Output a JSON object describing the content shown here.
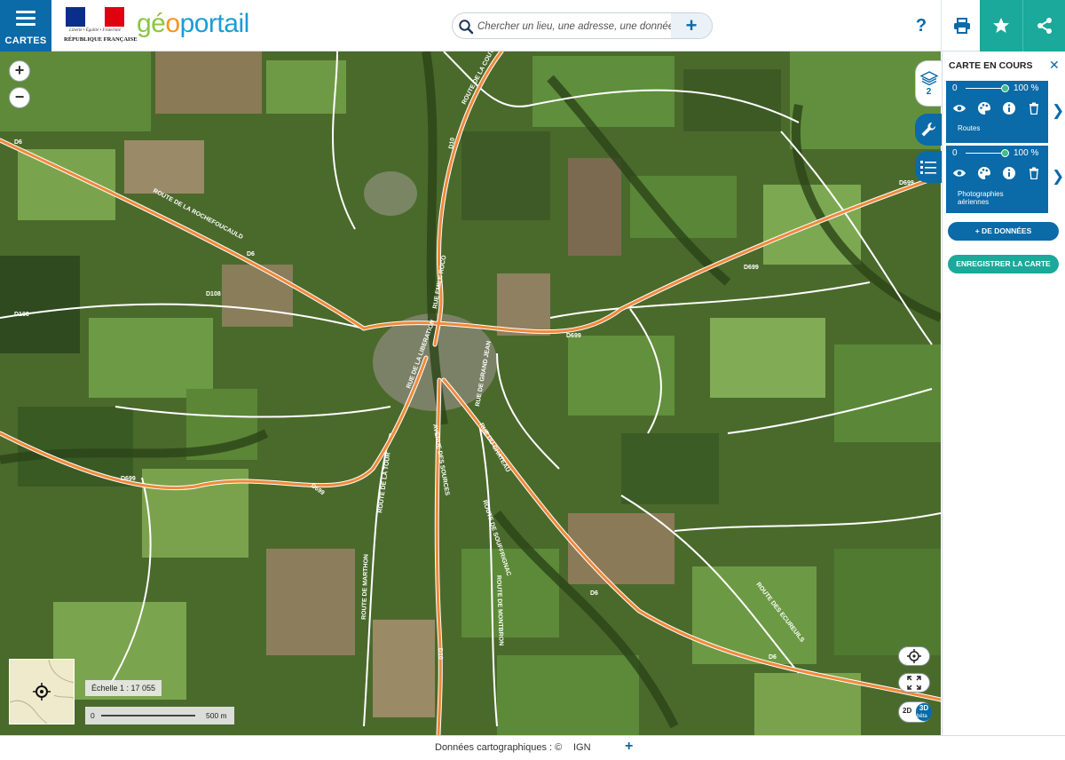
{
  "header": {
    "menu_label": "CARTES",
    "gov_logo_motto": "Liberté • Égalité • Fraternité",
    "gov_logo_name": "RÉPUBLIQUE FRANÇAISE",
    "brand_part1": "gé",
    "brand_part2": "o",
    "brand_part3": "portail",
    "search_placeholder": "Chercher un lieu, une adresse, une donnée",
    "search_add_label": "+",
    "help_label": "?",
    "icons": [
      "menu-icon",
      "search-icon",
      "print-icon",
      "star-icon",
      "share-icon"
    ],
    "colors": {
      "primary": "#0b6aa8",
      "accent": "#1aa99a",
      "brand_green": "#8cc63f",
      "brand_orange": "#f7931e",
      "brand_blue": "#1b9cd7"
    }
  },
  "map": {
    "zoom_in_label": "+",
    "zoom_out_label": "−",
    "scale_label": "Échelle 1 : 17 055",
    "scale_zero": "0",
    "scale_distance": "500 m",
    "mode_2d": "2D",
    "mode_3d": "3D",
    "mode_beta": "bêta",
    "road_labels": [
      "D6",
      "D6",
      "D6",
      "D699",
      "D699",
      "D699",
      "D699",
      "D108",
      "D108",
      "D10",
      "D10",
      "D6",
      "ROUTE DE LA ROCHEFOUCAULD",
      "RUE EMILE ROCO",
      "ROUTE DE LA COUTURE",
      "RUE DE LA LIBERATION",
      "RUE DE GRAND JEAN",
      "ROUTE DE MARTHON",
      "ROUTE DE SOUFFRIGNAC",
      "ROUTE DE MONTBRON",
      "ROUTE DES ECUREUILS",
      "ROUTE DE LA TOUR",
      "D699",
      "AVENUE DES SOURCES",
      "RUE DU CHATEAU"
    ]
  },
  "side_tabs": {
    "layers_count": "2",
    "icons": [
      "layers-icon",
      "wrench-icon",
      "legend-list-icon"
    ]
  },
  "panel": {
    "title": "CARTE EN COURS",
    "close_label": "✕",
    "layers": [
      {
        "opacity_min": "0",
        "opacity_value": "100 %",
        "opacity_fraction": 1.0,
        "name_lines": [
          "Routes"
        ]
      },
      {
        "opacity_min": "0",
        "opacity_value": "100 %",
        "opacity_fraction": 1.0,
        "name_lines": [
          "Photographies",
          "aériennes"
        ]
      }
    ],
    "layer_icons": [
      "eye-icon",
      "palette-icon",
      "info-icon",
      "trash-icon"
    ],
    "add_data_label": "+ DE DONNÉES",
    "save_map_label": "ENREGISTRER LA CARTE"
  },
  "footer": {
    "source_label": "Données cartographiques : ©",
    "provider": "IGN",
    "more_label": "+"
  }
}
